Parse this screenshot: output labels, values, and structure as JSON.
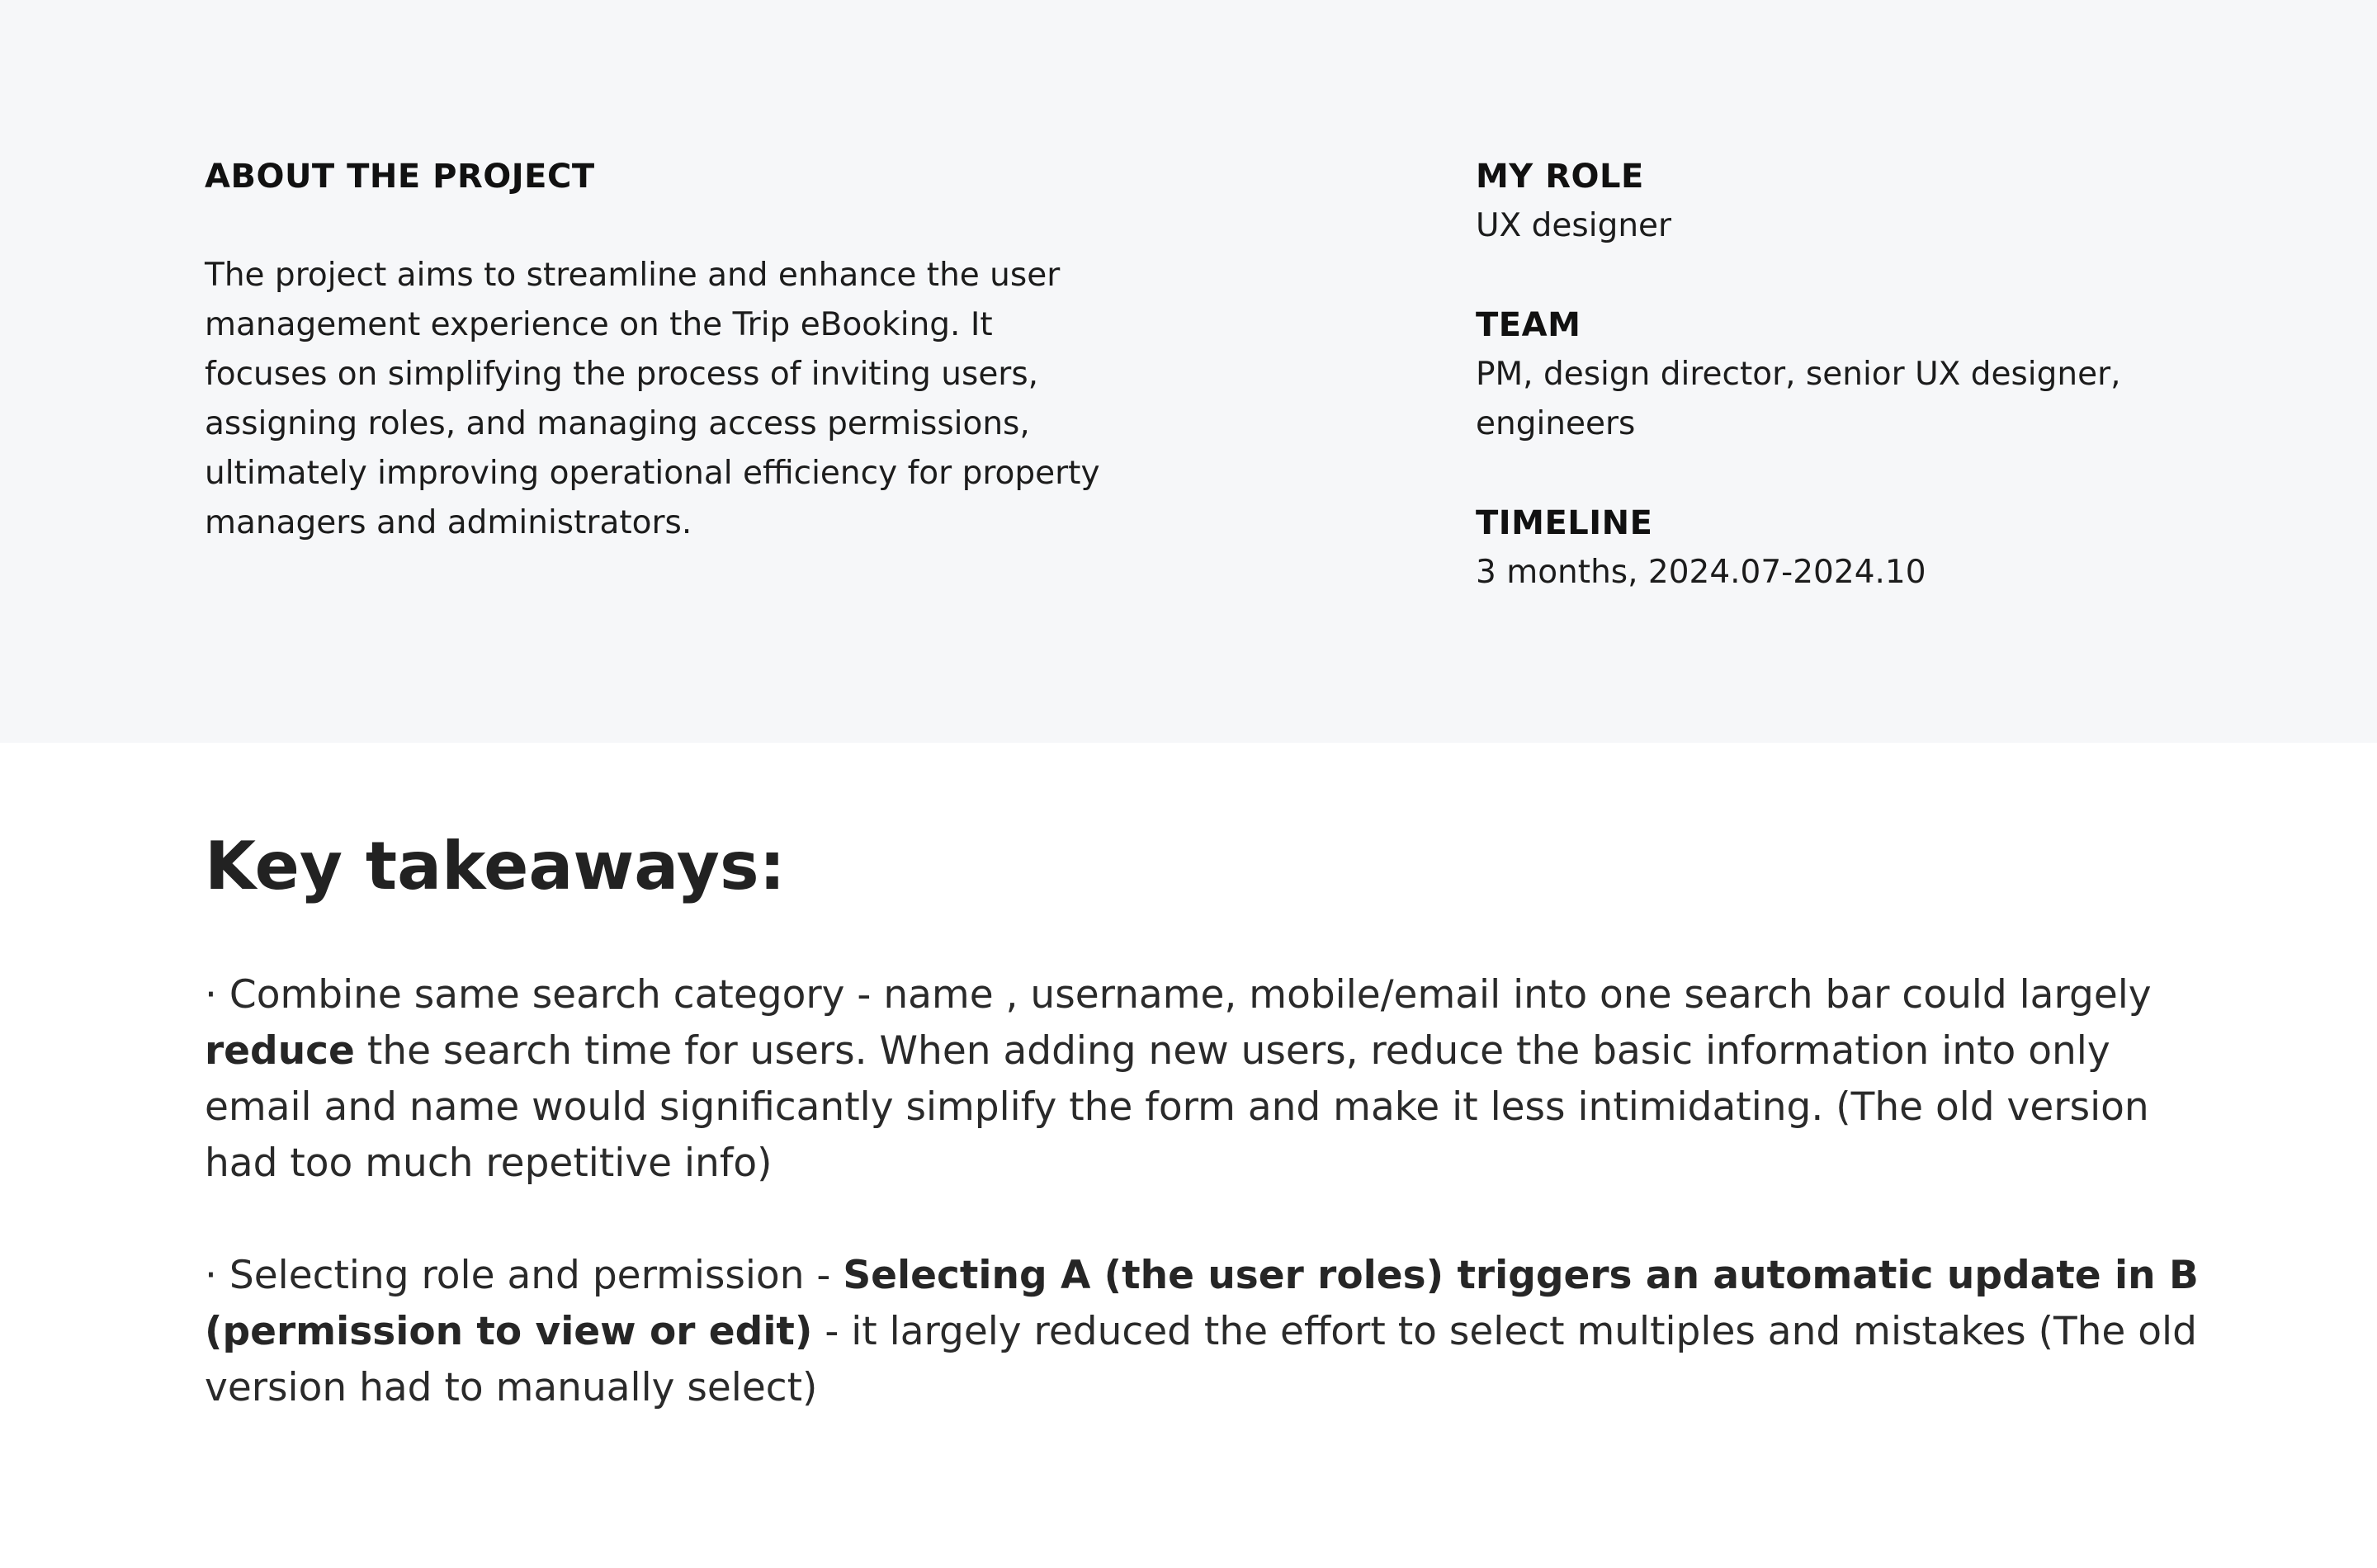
{
  "about": {
    "label": "ABOUT THE PROJECT",
    "text": "The project aims to streamline and enhance the user management experience on the Trip eBooking. It focuses on simplifying the process of inviting users, assigning roles, and managing access permissions, ultimately improving operational efficiency for property managers and administrators."
  },
  "meta": {
    "role_label": "MY ROLE",
    "role_value": "UX designer",
    "team_label": "TEAM",
    "team_value": "PM, design director, senior UX designer, engineers",
    "timeline_label": "TIMELINE",
    "timeline_value": "3 months, 2024.07-2024.10"
  },
  "takeaways": {
    "title": "Key takeaways:",
    "item1": {
      "before": "· Combine same search category - name , username, mobile/email  into one search bar could largely ",
      "bold": "reduce",
      "after": " the search time for users. When adding new users, reduce the basic information into only email and name would significantly simplify the form and make it less intimidating. (The old version had too much repetitive info)"
    },
    "item2": {
      "before": "· Selecting role and permission - ",
      "bold": "Selecting A (the user roles) triggers an automatic update in B (permission to view or edit)",
      "after": " - it largely reduced the effort to select multiples and mistakes (The old version had to manually select)"
    }
  }
}
